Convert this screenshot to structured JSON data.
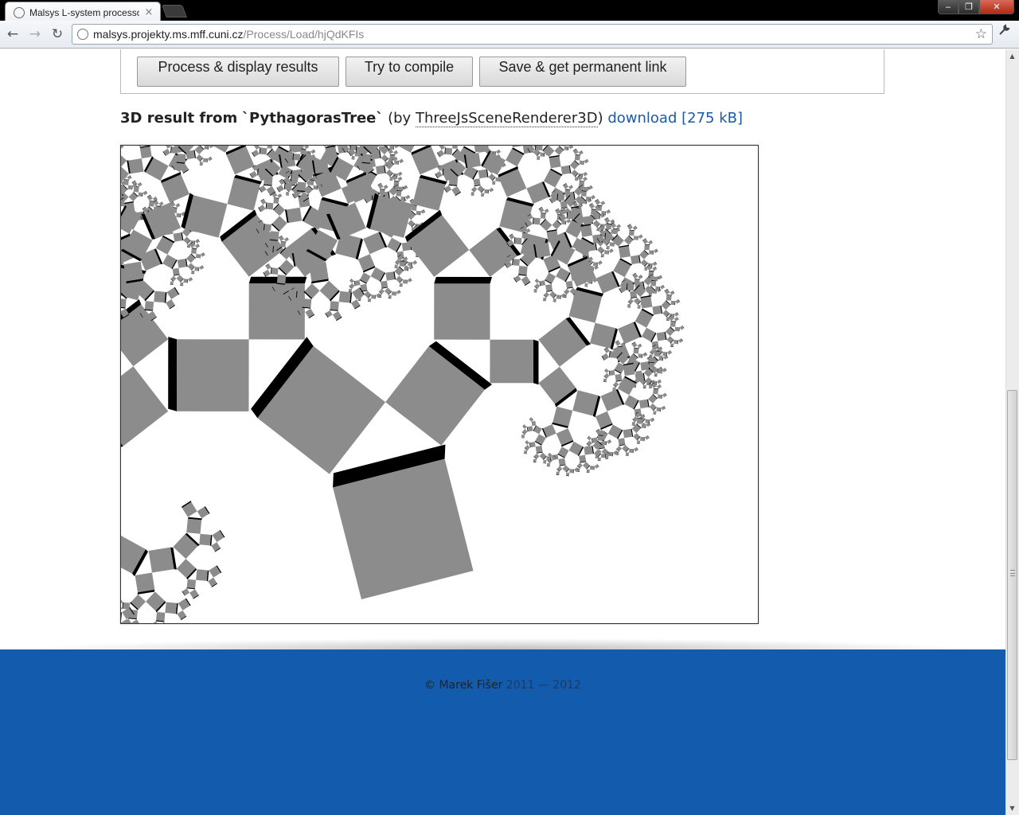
{
  "browser": {
    "tab_title": "Malsys L-system processor",
    "tab_close": "×",
    "url_host": "malsys.projekty.ms.mff.cuni.cz",
    "url_path": "/Process/Load/hjQdKFIs",
    "back_glyph": "←",
    "forward_glyph": "→",
    "reload_glyph": "↻",
    "star_glyph": "☆",
    "wrench_glyph": "🔧",
    "min_glyph": "‒",
    "max_glyph": "❐",
    "close_glyph": "✕"
  },
  "actions": {
    "process_label": "Process & display results",
    "compile_label": "Try to compile",
    "save_label": "Save & get permanent link"
  },
  "result": {
    "prefix": "3D result from",
    "lsystem_name": "`PythagorasTree`",
    "by_prefix": "(by",
    "renderer": "ThreeJsSceneRenderer3D",
    "by_suffix": ")",
    "download_label": "download",
    "download_size": "[275 kB]"
  },
  "footer": {
    "copyright": "© Marek Fišer",
    "years": "2011 — 2012"
  },
  "scroll": {
    "up_glyph": "▲",
    "down_glyph": "▼"
  },
  "colors": {
    "footer_bg": "#125bad",
    "link": "#1a5aa8",
    "square_fill": "#8c8c8c",
    "square_side": "#000000"
  },
  "render": {
    "model": "PythagorasTree",
    "icons": [
      "page-globe-icon",
      "back-icon",
      "forward-icon",
      "reload-icon",
      "bookmark-star-icon",
      "wrench-icon"
    ]
  }
}
